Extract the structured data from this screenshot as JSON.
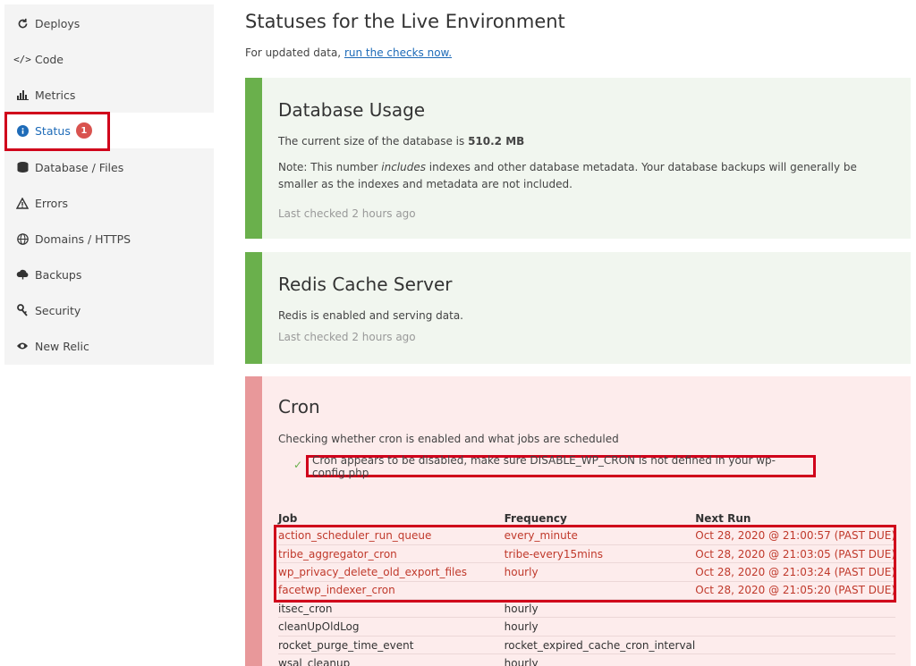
{
  "sidebar": {
    "items": [
      {
        "label": "Deploys",
        "icon": "refresh-icon"
      },
      {
        "label": "Code",
        "icon": "code-icon"
      },
      {
        "label": "Metrics",
        "icon": "bar-chart-icon"
      },
      {
        "label": "Status",
        "icon": "info-icon",
        "badge": "1"
      },
      {
        "label": "Database / Files",
        "icon": "database-icon"
      },
      {
        "label": "Errors",
        "icon": "warning-icon"
      },
      {
        "label": "Domains / HTTPS",
        "icon": "globe-icon"
      },
      {
        "label": "Backups",
        "icon": "cloud-upload-icon"
      },
      {
        "label": "Security",
        "icon": "key-icon"
      },
      {
        "label": "New Relic",
        "icon": "eye-icon"
      }
    ]
  },
  "main": {
    "title": "Statuses for the Live Environment",
    "intro_text": "For updated data, ",
    "intro_link": "run the checks now."
  },
  "database_card": {
    "title": "Database Usage",
    "size_text": "The current size of the database is ",
    "size_value": "510.2 MB",
    "note_prefix": "Note: This number ",
    "note_em": "includes",
    "note_suffix": " indexes and other database metadata. Your database backups will generally be smaller as the indexes and metadata are not included.",
    "last_checked": "Last checked 2 hours ago"
  },
  "redis_card": {
    "title": "Redis Cache Server",
    "text": "Redis is enabled and serving data.",
    "last_checked": "Last checked 2 hours ago"
  },
  "cron_card": {
    "title": "Cron",
    "subtitle": "Checking whether cron is enabled and what jobs are scheduled",
    "check_icon": "✓",
    "check_text": "Cron appears to be disabled, make sure DISABLE_WP_CRON is not defined in your wp-config.php",
    "table": {
      "headers": [
        "Job",
        "Frequency",
        "Next Run"
      ],
      "rows": [
        {
          "job": "action_scheduler_run_queue",
          "freq": "every_minute",
          "next": "Oct 28, 2020 @ 21:00:57 (PAST DUE)",
          "due": true
        },
        {
          "job": "tribe_aggregator_cron",
          "freq": "tribe-every15mins",
          "next": "Oct 28, 2020 @ 21:03:05 (PAST DUE)",
          "due": true
        },
        {
          "job": "wp_privacy_delete_old_export_files",
          "freq": "hourly",
          "next": "Oct 28, 2020 @ 21:03:24 (PAST DUE)",
          "due": true
        },
        {
          "job": "facetwp_indexer_cron",
          "freq": "",
          "next": "Oct 28, 2020 @ 21:05:20 (PAST DUE)",
          "due": true
        },
        {
          "job": "itsec_cron",
          "freq": "hourly",
          "next": "",
          "due": false
        },
        {
          "job": "cleanUpOldLog",
          "freq": "hourly",
          "next": "",
          "due": false
        },
        {
          "job": "rocket_purge_time_event",
          "freq": "rocket_expired_cache_cron_interval",
          "next": "",
          "due": false
        },
        {
          "job": "wsal_cleanup",
          "freq": "hourly",
          "next": "",
          "due": false
        }
      ]
    }
  },
  "colors": {
    "ok_bar": "#6ab04c",
    "err_bar": "#e8989a",
    "highlight": "#d0021b",
    "link": "#1e6bb8",
    "badge": "#d9534f"
  }
}
